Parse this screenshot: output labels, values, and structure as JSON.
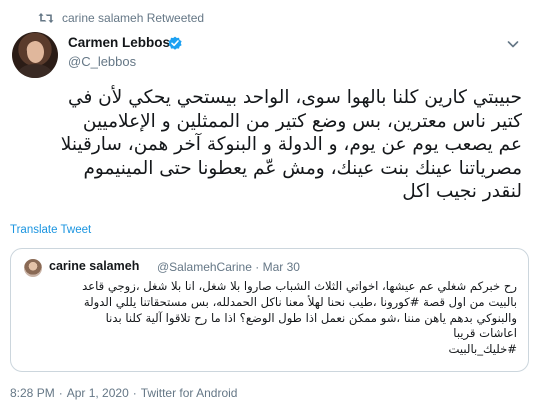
{
  "retweet": {
    "icon": "retweet-icon",
    "text": "carine salameh Retweeted"
  },
  "author": {
    "name": "Carmen Lebbos",
    "handle": "@C_lebbos",
    "verified": true,
    "verified_color": "#1da1f2"
  },
  "tweet": {
    "lines": [
      "حبيبتي كارين كلنا بالهوا سوى، الواحد بيستحي يحكي لأن في",
      "كتير ناس معترين، بس وضع كتير من الممثلين و الإعلاميين",
      "عم يصعب يوم عن يوم، و الدولة و البنوكة آخر همن، سارقينلا",
      "مصرياتنا عينك بنت عينك، ومش عّم يعطونا حتى المينيموم",
      "لنقدر نجيب اكل"
    ],
    "translate_label": "Translate Tweet"
  },
  "quoted": {
    "name": "carine salameh",
    "handle": "@SalamehCarine",
    "separator": "·",
    "date": "Mar 30",
    "lines": [
      "رح خبركم شغلي عم عيشها، اخواتي الثلاث الشباب صاروا بلا شغل، انا بلا شغل ،زوجي قاعد",
      "بالبيت من اول قصة #كورونا ،طيب نحنا لهلأ معنا ناكل الحمدلله، بس مستحقاتنا يللي الدولة",
      "والبنوكي بدهم ياهن مننا ،شو ممكن نعمل اذا طول الوضع؟ اذا ما رح تلاقوا آلية كلنا بدنا",
      "اعاشات قريبا",
      "#خليك_بالبيت"
    ]
  },
  "footer": {
    "time": "8:28 PM",
    "separator": "·",
    "date": "Apr 1, 2020",
    "source": "Twitter for Android"
  },
  "colors": {
    "link": "#1b95e0",
    "muted": "#657786",
    "border": "#ccd6dd",
    "text": "#14171a"
  }
}
